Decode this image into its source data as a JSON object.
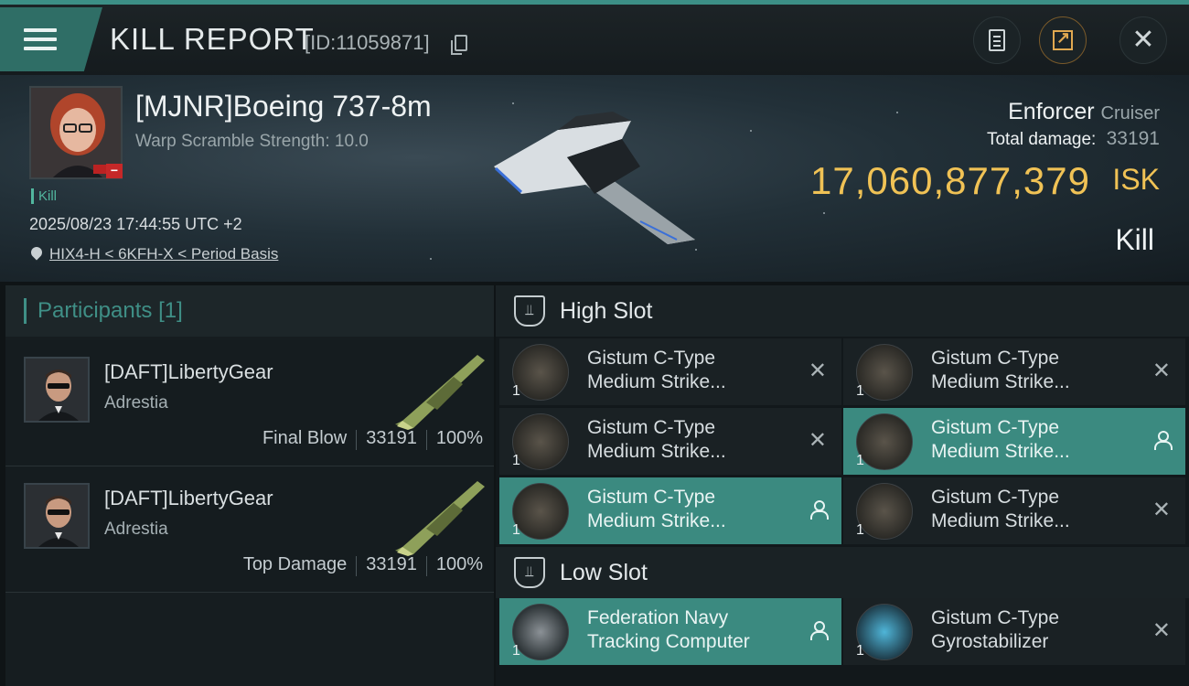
{
  "header": {
    "title": "KILL REPORT",
    "report_id": "[ID:11059871]"
  },
  "victim": {
    "name": "[MJNR]Boeing 737-8m",
    "warp_scramble": "Warp Scramble Strength: 10.0",
    "kill_tag": "Kill",
    "datetime": "2025/08/23 17:44:55 UTC +2",
    "location": "HIX4-H < 6KFH-X < Period Basis",
    "ship_name": "Enforcer",
    "ship_class": "Cruiser",
    "total_damage_label": "Total damage:",
    "total_damage": "33191",
    "isk_value": "17,060,877,379",
    "isk_unit": "ISK",
    "result": "Kill"
  },
  "participants": {
    "title": "Participants",
    "count": "[1]",
    "rows": [
      {
        "name": "[DAFT]LibertyGear",
        "corp": "Adrestia",
        "role": "Final Blow",
        "damage": "33191",
        "percent": "100%"
      },
      {
        "name": "[DAFT]LibertyGear",
        "corp": "Adrestia",
        "role": "Top Damage",
        "damage": "33191",
        "percent": "100%"
      }
    ]
  },
  "slots": {
    "high_title": "High Slot",
    "low_title": "Low Slot",
    "high": [
      {
        "line1": "Gistum C-Type",
        "line2": "Medium Strike...",
        "qty": "1",
        "status": "destroyed"
      },
      {
        "line1": "Gistum C-Type",
        "line2": "Medium Strike...",
        "qty": "1",
        "status": "destroyed"
      },
      {
        "line1": "Gistum C-Type",
        "line2": "Medium Strike...",
        "qty": "1",
        "status": "destroyed"
      },
      {
        "line1": "Gistum C-Type",
        "line2": "Medium Strike...",
        "qty": "1",
        "status": "dropped"
      },
      {
        "line1": "Gistum C-Type",
        "line2": "Medium Strike...",
        "qty": "1",
        "status": "dropped"
      },
      {
        "line1": "Gistum C-Type",
        "line2": "Medium Strike...",
        "qty": "1",
        "status": "destroyed"
      }
    ],
    "low": [
      {
        "line1": "Federation Navy",
        "line2": "Tracking Computer",
        "qty": "1",
        "status": "dropped"
      },
      {
        "line1": "Gistum C-Type",
        "line2": "Gyrostabilizer",
        "qty": "1",
        "status": "destroyed"
      }
    ],
    "destroyed_glyph": "✕"
  },
  "colors": {
    "accent": "#3b8a80",
    "isk": "#f0c255",
    "kill_green": "#52b79f"
  }
}
